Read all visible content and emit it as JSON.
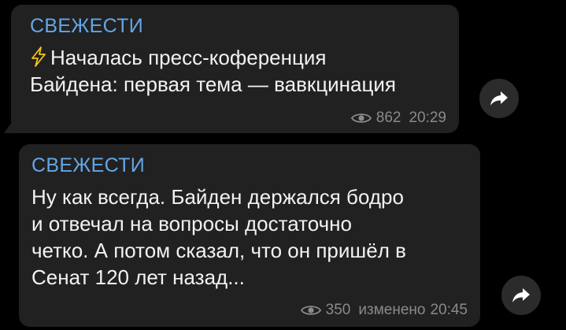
{
  "messages": [
    {
      "sender": "СВЕЖЕСТИ",
      "icon": "lightning-icon",
      "text_line1": "Началась пресс-коференция",
      "text_line2": "Байдена: первая тема — вавкцинация",
      "views": "862",
      "time": "20:29",
      "share_icon": "share-arrow-icon"
    },
    {
      "sender": "СВЕЖЕСТИ",
      "text_line1": "Ну как всегда. Байден держался бодро",
      "text_line2": "и отвечал на вопросы достаточно",
      "text_line3": "четко. А потом сказал, что он пришёл в",
      "text_line4": "Сенат 120 лет назад...",
      "views": "350",
      "status": "изменено",
      "time": "20:45",
      "share_icon": "share-arrow-icon"
    }
  ],
  "colors": {
    "background": "#000000",
    "bubble": "#212121",
    "sender": "#63a6e8",
    "meta": "#8a8a8a",
    "lightning": "#f5c518"
  }
}
